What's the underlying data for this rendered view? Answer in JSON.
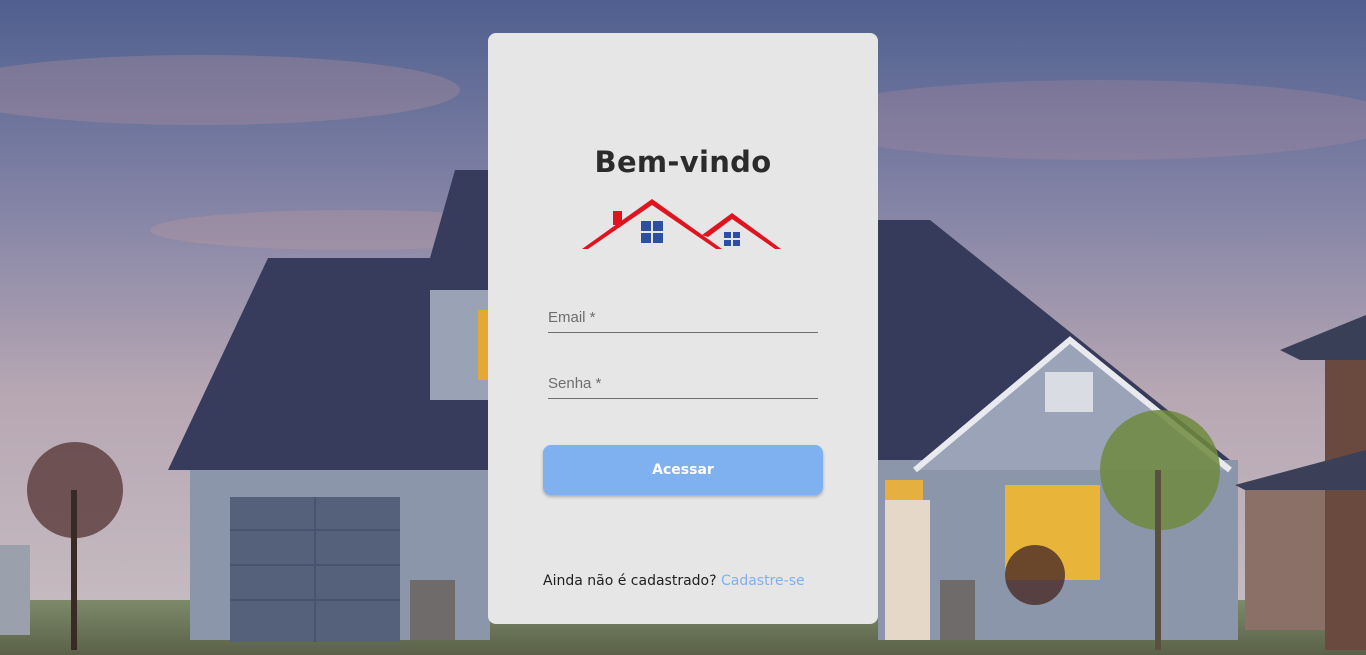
{
  "colors": {
    "card_bg": "#e6e6e6",
    "primary_button": "#7fb0f0",
    "link": "#7fb0f0",
    "logo_roof": "#e0141e",
    "logo_window": "#2c4fa0"
  },
  "login": {
    "title": "Bem-vindo",
    "logo_icon": "house-roofs-logo-icon",
    "email_placeholder": "Email *",
    "password_placeholder": "Senha *",
    "submit_label": "Acessar",
    "signup_prompt": "Ainda não é cadastrado?",
    "signup_link": "Cadastre-se"
  }
}
